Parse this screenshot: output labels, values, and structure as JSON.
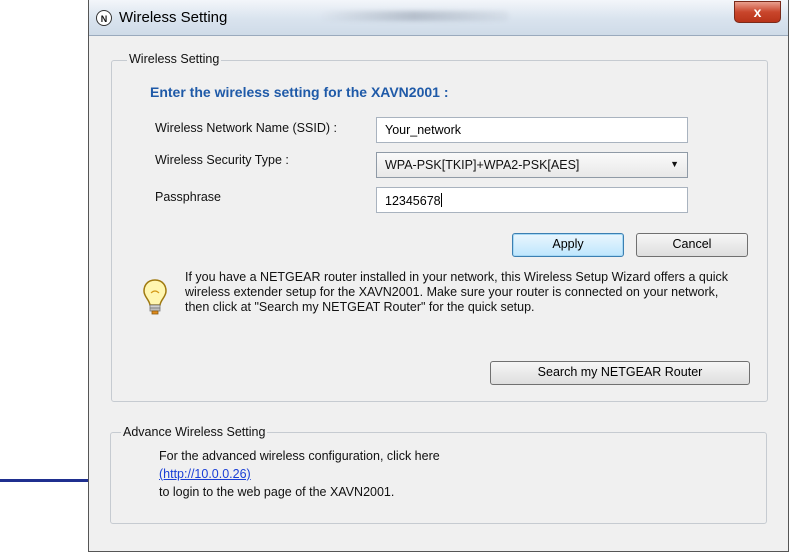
{
  "window": {
    "title": "Wireless Setting",
    "title_icon": "N",
    "close_label": "x"
  },
  "wireless_group": {
    "legend": "Wireless Setting",
    "heading": "Enter the wireless setting for the XAVN2001 :",
    "ssid_label": "Wireless Network Name (SSID) :",
    "ssid_value": "Your_network",
    "security_label": "Wireless Security Type :",
    "security_value": "WPA-PSK[TKIP]+WPA2-PSK[AES]",
    "passphrase_label": "Passphrase",
    "passphrase_value": "12345678",
    "apply_label": "Apply",
    "cancel_label": "Cancel",
    "info_text": "If you have a NETGEAR router installed in your network, this Wireless Setup Wizard offers a quick wireless extender setup for the XAVN2001. Make sure your router is connected on your network, then click at \"Search my NETGEAT Router\" for the quick setup.",
    "search_button_label": "Search my NETGEAR Router"
  },
  "advanced_group": {
    "legend": "Advance Wireless Setting",
    "line1": "For the advanced wireless configuration, click here",
    "link_text": "(http://10.0.0.26)",
    "line3": "to login to the web page of the XAVN2001."
  },
  "icons": {
    "info": "lightbulb-icon",
    "callout": "arrow-pointer-icon"
  },
  "colors": {
    "heading": "#1f5aa8",
    "link": "#1a3fd6",
    "callout_arrow": "#1f2f8f"
  }
}
